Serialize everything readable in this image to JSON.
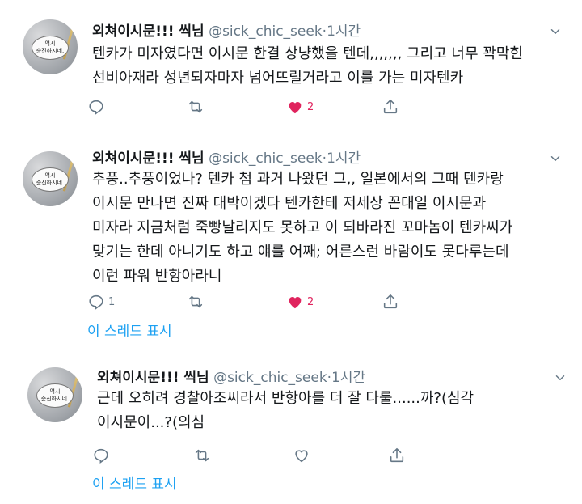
{
  "tweets": [
    {
      "name": "외쳐이시문!!! 씩님",
      "handle": "@sick_chic_seek",
      "dot": "·",
      "time": "1시간",
      "avatar_text": [
        "역시",
        "순진하시네."
      ],
      "text_lines": [
        "텐카가 미자였다면 이시문 한결 상냥했을 텐데,,,,,,, 그리고 너무 꽉막힌",
        "선비아재라 성년되자마자 넘어뜨릴거라고 이를 가는 미자텐카"
      ],
      "reply_count": "",
      "like_count": "2",
      "liked": true,
      "thread_link": ""
    },
    {
      "name": "외쳐이시문!!! 씩님",
      "handle": "@sick_chic_seek",
      "dot": "·",
      "time": "1시간",
      "avatar_text": [
        "역시",
        "순진하시네."
      ],
      "text_lines": [
        "추풍..추풍이었나? 텐카 첨 과거 나왔던 그,, 일본에서의 그때 텐카랑",
        "이시문 만나면 진짜 대박이겠다 텐카한테 저세상 꼰대일 이시문과",
        "미자라 지금처럼 죽빵날리지도 못하고 이 되바라진 꼬마놈이 텐카씨가",
        "맞기는 한데 아니기도 하고 얘를 어째; 어른스런 바람이도 못다루는데",
        "이런 파워 반항아라니"
      ],
      "reply_count": "1",
      "like_count": "2",
      "liked": true,
      "thread_link": "이 스레드 표시"
    },
    {
      "name": "외쳐이시문!!! 씩님",
      "handle": "@sick_chic_seek",
      "dot": "·",
      "time": "1시간",
      "avatar_text": [
        "역시",
        "순진하시네."
      ],
      "text_lines": [
        "근데 오히려 경찰아조씨라서 반항아를 더 잘 다룰......까?(심각",
        "이시문이...?(의심"
      ],
      "reply_count": "",
      "like_count": "",
      "liked": false,
      "thread_link": "이 스레드 표시"
    }
  ],
  "colors": {
    "like": "#e0245e",
    "icon": "#657786",
    "link": "#1da1f2"
  },
  "icons": [
    "reply-icon",
    "retweet-icon",
    "like-icon",
    "share-icon",
    "chevron-down-icon"
  ]
}
